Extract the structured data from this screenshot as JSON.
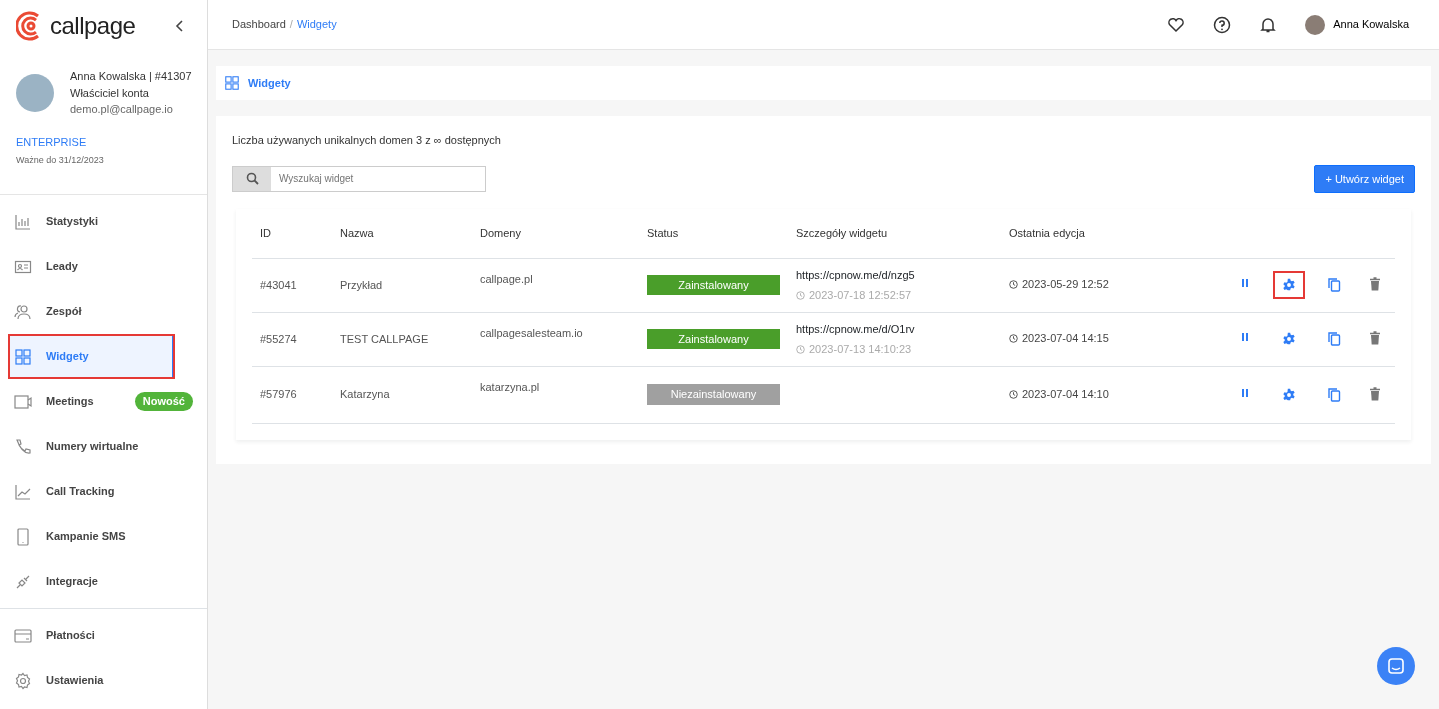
{
  "sidebar": {
    "logo": "callpage",
    "account": {
      "name": "Anna Kowalska | #41307",
      "role": "Właściciel konta",
      "email": "demo.pl@callpage.io",
      "plan": "ENTERPRISE",
      "valid": "Ważne do 31/12/2023"
    },
    "items": [
      {
        "label": "Statystyki",
        "selected": false,
        "highlighted": false
      },
      {
        "label": "Leady",
        "selected": false,
        "highlighted": false
      },
      {
        "label": "Zespół",
        "selected": false,
        "highlighted": false
      },
      {
        "label": "Widgety",
        "selected": true,
        "highlighted": true
      },
      {
        "label": "Meetings",
        "selected": false,
        "highlighted": false,
        "badge": "Nowość"
      },
      {
        "label": "Numery wirtualne",
        "selected": false,
        "highlighted": false
      },
      {
        "label": "Call Tracking",
        "selected": false,
        "highlighted": false
      },
      {
        "label": "Kampanie SMS",
        "selected": false,
        "highlighted": false
      },
      {
        "label": "Integracje",
        "selected": false,
        "highlighted": false
      },
      {
        "label": "Płatności",
        "selected": false,
        "highlighted": false
      },
      {
        "label": "Ustawienia",
        "selected": false,
        "highlighted": false
      }
    ]
  },
  "breadcrumb": {
    "separator": "/",
    "items": [
      {
        "label": "Dashboard",
        "selected": false
      },
      {
        "label": "Widgety",
        "selected": true
      }
    ]
  },
  "user": {
    "name": "Anna Kowalska"
  },
  "page_title": "Widgety",
  "usage": "Liczba używanych unikalnych domen 3 z ∞ dostępnych",
  "search": {
    "placeholder": "Wyszukaj widget"
  },
  "create_button": "+ Utwórz widget",
  "table": {
    "columns": [
      "ID",
      "Nazwa",
      "Domeny",
      "Status",
      "Szczegóły widgetu",
      "Ostatnia edycja"
    ],
    "rows": [
      {
        "id": "#43041",
        "name": "Przykład",
        "domain": "callpage.pl",
        "status": "Zainstalowany",
        "installed": true,
        "url": "https://cpnow.me/d/nzg5",
        "url_time": "2023-07-18 12:52:57",
        "edited": "2023-05-29 12:52",
        "settings_highlighted": true
      },
      {
        "id": "#55274",
        "name": "TEST CALLPAGE",
        "domain": "callpagesalesteam.io",
        "status": "Zainstalowany",
        "installed": true,
        "url": "https://cpnow.me/d/O1rv",
        "url_time": "2023-07-13 14:10:23",
        "edited": "2023-07-04 14:15",
        "settings_highlighted": false
      },
      {
        "id": "#57976",
        "name": "Katarzyna",
        "domain": "katarzyna.pl",
        "status": "Niezainstalowany",
        "installed": false,
        "edited": "2023-07-04 14:10",
        "settings_highlighted": false
      }
    ]
  }
}
